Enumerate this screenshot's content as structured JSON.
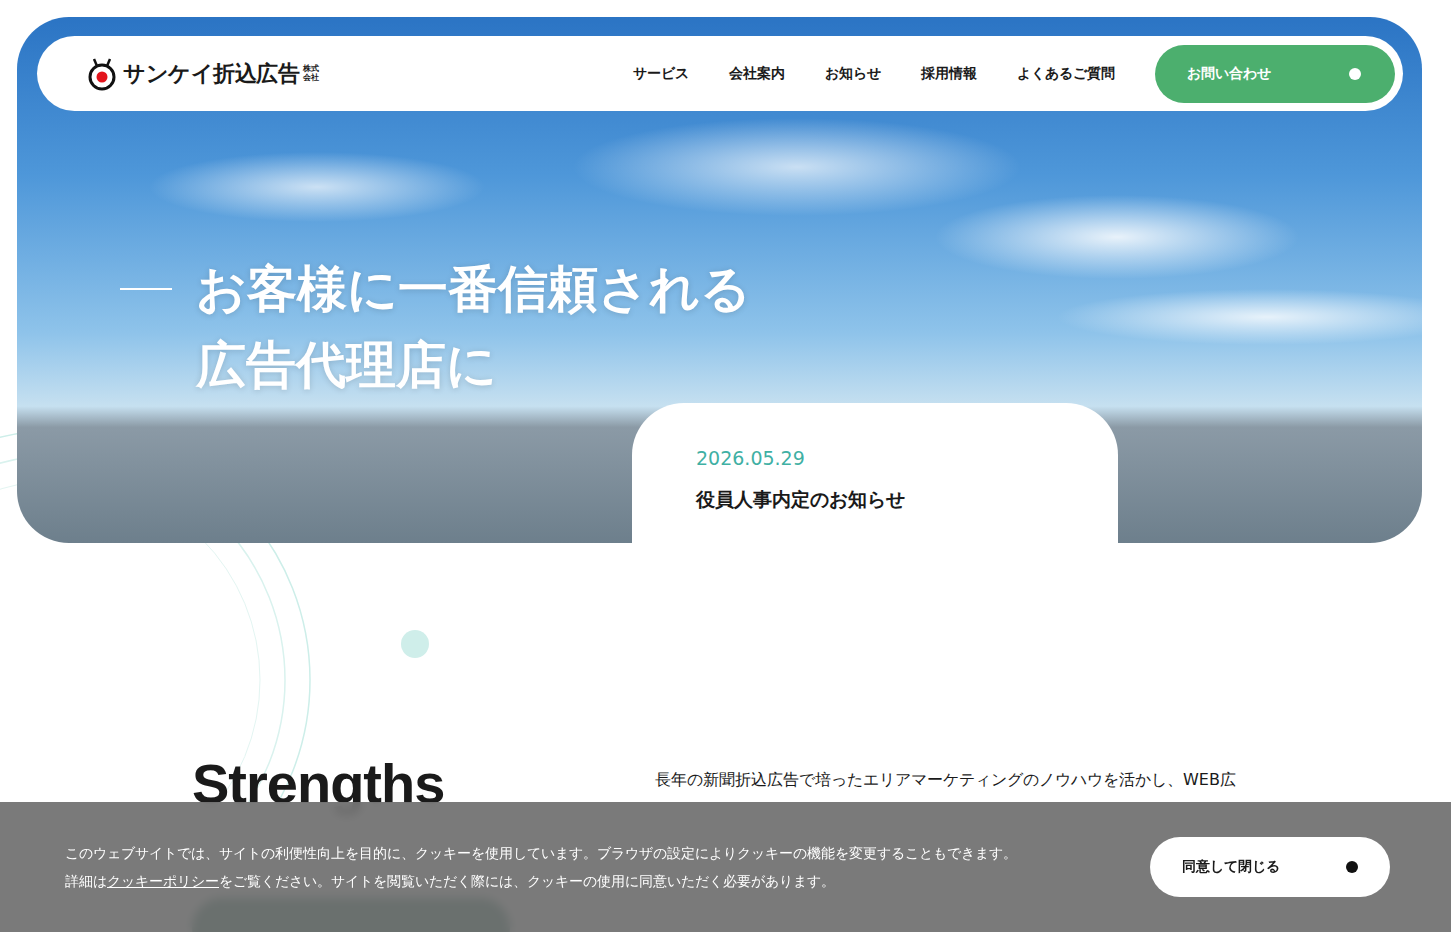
{
  "logo": {
    "name": "サンケイ折込広告",
    "suffix": [
      "株式",
      "会社"
    ]
  },
  "nav": {
    "items": [
      "サービス",
      "会社案内",
      "お知らせ",
      "採用情報",
      "よくあるご質問"
    ],
    "cta": "お問い合わせ"
  },
  "hero": {
    "lines": [
      "お客様に一番信頼される",
      "広告代理店に"
    ]
  },
  "news": {
    "date": "2026.05.29",
    "title": "役員人事内定のお知らせ"
  },
  "strengths": {
    "heading": "Strengths",
    "text": "長年の新聞折込広告で培ったエリアマーケティングのノウハウを活かし、WEB広"
  },
  "cookie": {
    "line1": "このウェブサイトでは、サイトの利便性向上を目的に、クッキーを使用しています。ブラウザの設定によりクッキーの機能を変更することもできます。",
    "line2_before": "詳細は",
    "link": "クッキーポリシー",
    "line2_after": "をご覧ください。サイトを閲覧いただく際には、クッキーの使用に同意いただく必要があります。",
    "button": "同意して閉じる"
  }
}
